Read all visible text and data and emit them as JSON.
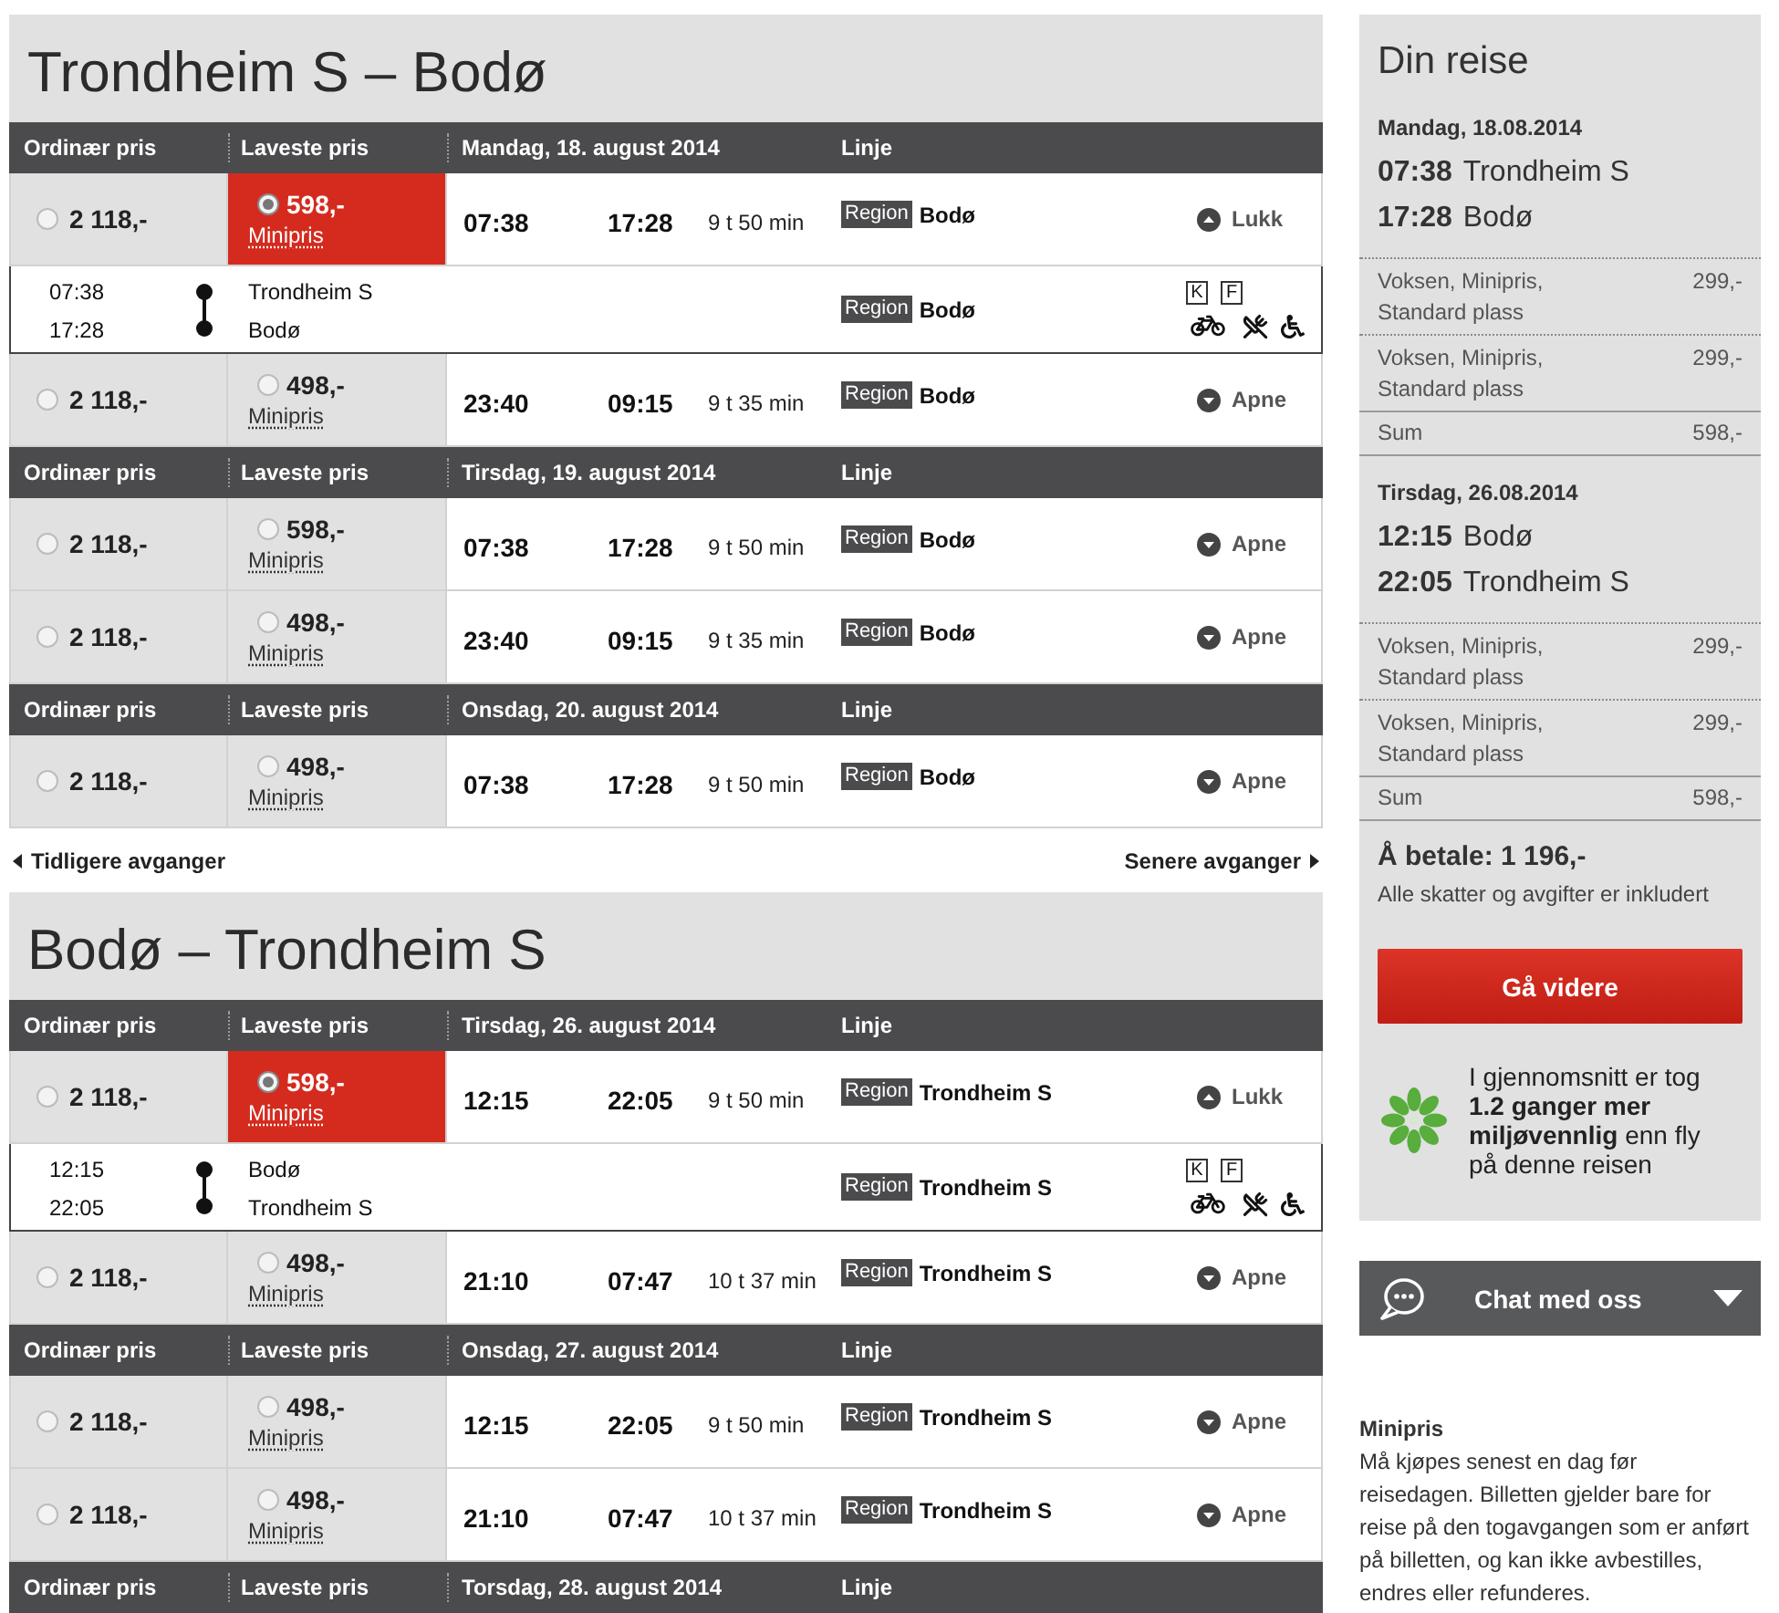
{
  "journeys": [
    {
      "title": "Trondheim S – Bodø",
      "days": [
        {
          "header": {
            "regular": "Ordinær pris",
            "lowest": "Laveste pris",
            "date": "Mandag, 18. august 2014",
            "line": "Linje"
          },
          "departures": [
            {
              "regular_price": "2 118,-",
              "regular_selected": false,
              "lowest_price": "598,-",
              "lowest_selected": true,
              "fare_type": "Minipris",
              "departure": "07:38",
              "arrival": "17:28",
              "duration": "9 t 50 min",
              "line_badge": "Region",
              "line_name": "Bodø",
              "toggle": "Lukk",
              "expanded": true,
              "details": {
                "departure": "07:38",
                "arrival": "17:28",
                "from": "Trondheim S",
                "to": "Bodø",
                "line_badge": "Region",
                "line_name": "Bodø",
                "facility_codes": [
                  "K",
                  "F"
                ]
              }
            },
            {
              "regular_price": "2 118,-",
              "regular_selected": false,
              "lowest_price": "498,-",
              "lowest_selected": false,
              "fare_type": "Minipris",
              "departure": "23:40",
              "arrival": "09:15",
              "duration": "9 t 35 min",
              "line_badge": "Region",
              "line_name": "Bodø",
              "toggle": "Apne",
              "expanded": false
            }
          ]
        },
        {
          "header": {
            "regular": "Ordinær pris",
            "lowest": "Laveste pris",
            "date": "Tirsdag, 19. august 2014",
            "line": "Linje"
          },
          "departures": [
            {
              "regular_price": "2 118,-",
              "regular_selected": false,
              "lowest_price": "598,-",
              "lowest_selected": false,
              "fare_type": "Minipris",
              "departure": "07:38",
              "arrival": "17:28",
              "duration": "9 t 50 min",
              "line_badge": "Region",
              "line_name": "Bodø",
              "toggle": "Apne",
              "expanded": false
            },
            {
              "regular_price": "2 118,-",
              "regular_selected": false,
              "lowest_price": "498,-",
              "lowest_selected": false,
              "fare_type": "Minipris",
              "departure": "23:40",
              "arrival": "09:15",
              "duration": "9 t 35 min",
              "line_badge": "Region",
              "line_name": "Bodø",
              "toggle": "Apne",
              "expanded": false
            }
          ]
        },
        {
          "header": {
            "regular": "Ordinær pris",
            "lowest": "Laveste pris",
            "date": "Onsdag, 20. august 2014",
            "line": "Linje"
          },
          "departures": [
            {
              "regular_price": "2 118,-",
              "regular_selected": false,
              "lowest_price": "498,-",
              "lowest_selected": false,
              "fare_type": "Minipris",
              "departure": "07:38",
              "arrival": "17:28",
              "duration": "9 t 50 min",
              "line_badge": "Region",
              "line_name": "Bodø",
              "toggle": "Apne",
              "expanded": false
            }
          ]
        }
      ],
      "nav": {
        "previous": "Tidligere avganger",
        "next": "Senere avganger"
      }
    },
    {
      "title": "Bodø – Trondheim S",
      "days": [
        {
          "header": {
            "regular": "Ordinær pris",
            "lowest": "Laveste pris",
            "date": "Tirsdag, 26. august 2014",
            "line": "Linje"
          },
          "departures": [
            {
              "regular_price": "2 118,-",
              "regular_selected": false,
              "lowest_price": "598,-",
              "lowest_selected": true,
              "fare_type": "Minipris",
              "departure": "12:15",
              "arrival": "22:05",
              "duration": "9 t 50 min",
              "line_badge": "Region",
              "line_name": "Trondheim S",
              "toggle": "Lukk",
              "expanded": true,
              "details": {
                "departure": "12:15",
                "arrival": "22:05",
                "from": "Bodø",
                "to": "Trondheim S",
                "line_badge": "Region",
                "line_name": "Trondheim S",
                "facility_codes": [
                  "K",
                  "F"
                ]
              }
            },
            {
              "regular_price": "2 118,-",
              "regular_selected": false,
              "lowest_price": "498,-",
              "lowest_selected": false,
              "fare_type": "Minipris",
              "departure": "21:10",
              "arrival": "07:47",
              "duration": "10 t 37 min",
              "line_badge": "Region",
              "line_name": "Trondheim S",
              "toggle": "Apne",
              "expanded": false
            }
          ]
        },
        {
          "header": {
            "regular": "Ordinær pris",
            "lowest": "Laveste pris",
            "date": "Onsdag, 27. august 2014",
            "line": "Linje"
          },
          "departures": [
            {
              "regular_price": "2 118,-",
              "regular_selected": false,
              "lowest_price": "498,-",
              "lowest_selected": false,
              "fare_type": "Minipris",
              "departure": "12:15",
              "arrival": "22:05",
              "duration": "9 t 50 min",
              "line_badge": "Region",
              "line_name": "Trondheim S",
              "toggle": "Apne",
              "expanded": false
            },
            {
              "regular_price": "2 118,-",
              "regular_selected": false,
              "lowest_price": "498,-",
              "lowest_selected": false,
              "fare_type": "Minipris",
              "departure": "21:10",
              "arrival": "07:47",
              "duration": "10 t 37 min",
              "line_badge": "Region",
              "line_name": "Trondheim S",
              "toggle": "Apne",
              "expanded": false
            }
          ]
        },
        {
          "header": {
            "regular": "Ordinær pris",
            "lowest": "Laveste pris",
            "date": "Torsdag, 28. august 2014",
            "line": "Linje"
          }
        }
      ]
    }
  ],
  "summary": {
    "title": "Din reise",
    "trips": [
      {
        "date": "Mandag, 18.08.2014",
        "stops": [
          {
            "time": "07:38",
            "station": "Trondheim S"
          },
          {
            "time": "17:28",
            "station": "Bodø"
          }
        ],
        "tickets": [
          {
            "description": "Voksen, Minipris, Standard plass",
            "price": "299,-"
          },
          {
            "description": "Voksen, Minipris, Standard plass",
            "price": "299,-"
          }
        ],
        "sum_label": "Sum",
        "sum": "598,-"
      },
      {
        "date": "Tirsdag, 26.08.2014",
        "stops": [
          {
            "time": "12:15",
            "station": "Bodø"
          },
          {
            "time": "22:05",
            "station": "Trondheim S"
          }
        ],
        "tickets": [
          {
            "description": "Voksen, Minipris, Standard plass",
            "price": "299,-"
          },
          {
            "description": "Voksen, Minipris, Standard plass",
            "price": "299,-"
          }
        ],
        "sum_label": "Sum",
        "sum": "598,-"
      }
    ],
    "total": "Å betale: 1 196,-",
    "total_note": "Alle skatter og avgifter er inkludert",
    "continue_button": "Gå videre",
    "eco_text": "I gjennomsnitt er tog **1.2 ganger mer miljøvennlig** enn fly på denne reisen"
  },
  "chat": {
    "label": "Chat med oss"
  },
  "fare_info": {
    "title": "Minipris",
    "text": "Må kjøpes senest en dag før reisedagen. Billetten gjelder bare for reise på den togavgangen som er anført på billetten, og kan ikke avbestilles, endres eller refunderes."
  }
}
